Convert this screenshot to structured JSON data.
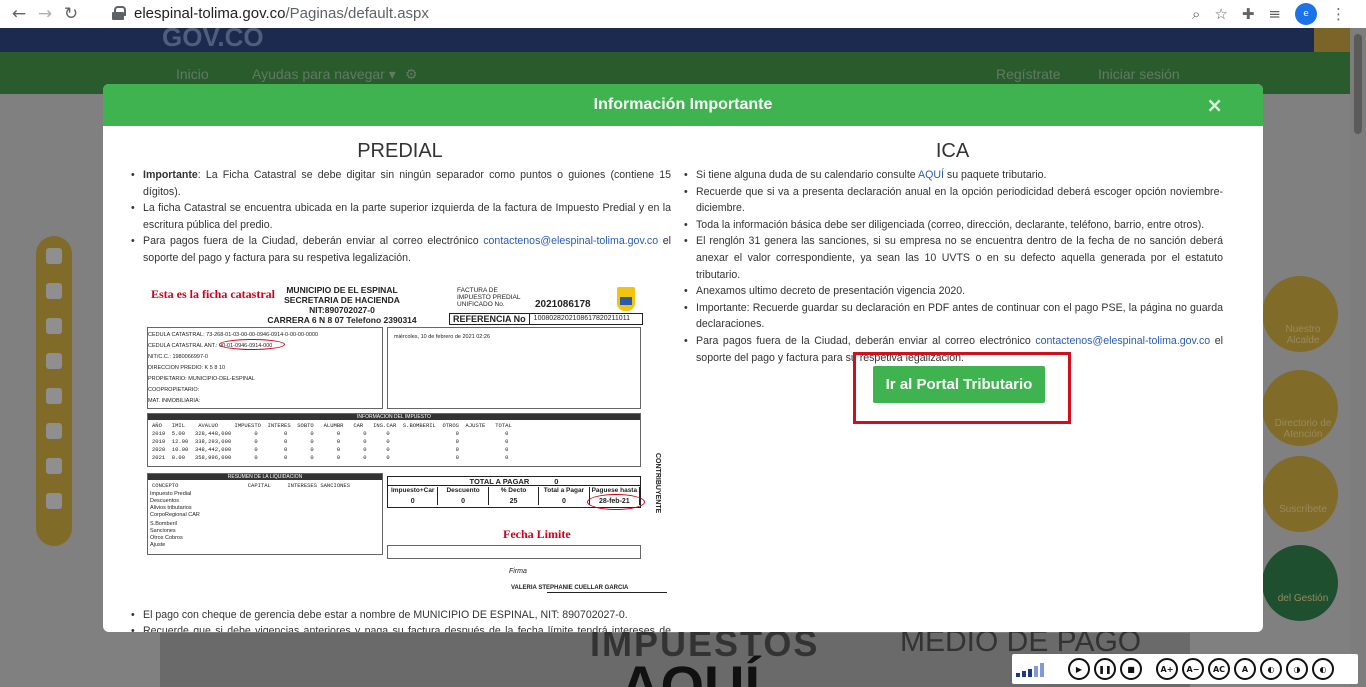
{
  "browser": {
    "url_domain": "elespinal-tolima.gov.co",
    "url_path": "/Paginas/default.aspx",
    "profile_initials": "e"
  },
  "background_page": {
    "logo_text": "GOV.CO",
    "nav": [
      "Inicio",
      "Ayudas para navegar ▾",
      "Regístrate",
      "Iniciar sesión"
    ],
    "side_buttons": [
      "Nuestro Alcalde",
      "Directorio de Atención",
      "Suscríbete",
      "del Gestión"
    ],
    "bottom_texts": [
      "IMPUESTOS",
      "MEDIO DE PAGO",
      "AQUÍ"
    ]
  },
  "modal": {
    "title": "Información Importante",
    "close_label": "×",
    "predial": {
      "heading": "PREDIAL",
      "items_top": [
        {
          "bold": "Importante",
          "text": ": La Ficha Catastral se debe digitar sin ningún separador como puntos o guiones (contiene 15 dígitos)."
        },
        {
          "bold": "",
          "text": "La ficha Catastral se encuentra ubicada en la parte superior izquierda de la factura de Impuesto Predial y en la escritura pública del predio."
        },
        {
          "bold": "",
          "text": "Para pagos fuera de la Ciudad, deberán enviar al correo electrónico ",
          "link": "contactenos@elespinal-tolima.gov.co",
          "after": " el soporte del pago y factura para su respetiva legalización."
        }
      ],
      "items_bottom": [
        "El pago con cheque de gerencia debe estar a nombre de MUNICIPIO DE ESPINAL, NIT: 890702027-0.",
        "Recuerde que si debe vigencias anteriores y paga su factura después de la fecha límite tendrá intereses de mora."
      ],
      "invoice": {
        "red_label": "Esta es la ficha catastral",
        "title_lines": [
          "MUNICIPIO DE EL ESPINAL",
          "SECRETARIA DE HACIENDA",
          "NIT:890702027-0",
          "CARRERA 6 N 8 07 Telefono 2390314"
        ],
        "factura_lines": [
          "FACTURA DE",
          "IMPUESTO PREDIAL",
          "UNIFICADO    No."
        ],
        "factura_number": "2021086178",
        "referencia_label": "REFERENCIA No",
        "referencia_value": "1008028202108617820211011",
        "fields": [
          "CEDULA CATASTRAL:    73-268-01-03-00-00-0946-0914-0-00-00-0000",
          "CEDULA CATASTRAL ANT.:   00-01-0946-0914-000",
          "NIT/C.C.:           1980066997-0",
          "DIRECCION PREDIO:   K 5 8 10",
          "PROPIETARIO:        MUNICIPIO-DEL-ESPINAL",
          "COOPROPIETARIO:",
          "MAT. INMOBILIARIA:"
        ],
        "fecha_expedicion": "miércoles, 10 de febrero de 2021 02:26",
        "impuesto_header": "INFORMACION DEL IMPUESTO",
        "impuesto_cols": "AÑO   IMIL    AVALUO     IMPUESTO  INTERES  SOBTO   ALUMBR   CAR   INS.CAR  S.BOMBERIL  OTROS  AJUSTE   TOTAL",
        "impuesto_rows": [
          "2019  5.00   328,448,000       0        0       0       0       0      0                    0              0",
          "2019  12.00  338,293,000       0        0       0       0       0      0                    0              0",
          "2020  10.00  348,442,000       0        0       0       0       0      0                    0              0",
          "2021  8.00   358,996,000       0        0       0       0       0      0                    0              0"
        ],
        "liquidacion_header": "RESUMEN DE LA LIQUIDACION",
        "liq_cols": "CONCEPTO                     CAPITAL     INTERESES SANCIONES",
        "liq_rows": [
          "Impuesto Predial",
          "Descuentos",
          "Alivios tributarios",
          "CorpoRegional CAR",
          "S.Bomberil",
          "Sanciones",
          "Otros Cobros",
          "Ajuste"
        ],
        "total_header": "TOTAL A PAGAR",
        "total_amount": "0",
        "total_cols": [
          "Impuesto+Car",
          "Descuento",
          "% Decto",
          "Total a Pagar",
          "Paguese hasta"
        ],
        "total_vals": [
          "0",
          "0",
          "25",
          "0",
          "28-feb-21"
        ],
        "fecha_limite": "Fecha Limite",
        "vertical_label": "CONTRIBUYENTE",
        "firma_label": "Firma",
        "signer": "VALERIA STEPHANIE CUELLAR GARCIA"
      }
    },
    "ica": {
      "heading": "ICA",
      "items": [
        {
          "text": "Si tiene alguna duda de su calendario consulte ",
          "link": "AQUÍ",
          "after": " su paquete tributario."
        },
        {
          "text": "Recuerde que si va a presenta declaración anual en la opción periodicidad deberá escoger opción noviembre-diciembre."
        },
        {
          "text": "Toda la información básica debe ser diligenciada (correo, dirección, declarante, teléfono, barrio, entre otros)."
        },
        {
          "text": "El renglón 31 genera las sanciones, si su empresa no se encuentra dentro de la fecha de no sanción deberá anexar el valor correspondiente, ya sean las 10 UVTS o en su defecto aquella generada por el estatuto tributario."
        },
        {
          "text": "Anexamos ultimo decreto de presentación vigencia 2020."
        },
        {
          "text": "Importante: Recuerde guardar su declaración en PDF antes de continuar con el pago PSE, la página no guarda declaraciones."
        },
        {
          "text": "Para pagos fuera de la Ciudad, deberán enviar al correo electrónico ",
          "link": "contactenos@elespinal-tolima.gov.co",
          "after": " el soporte del pago y factura para su respetiva legalización."
        }
      ],
      "portal_button": "Ir al Portal Tributario"
    }
  },
  "accessibility_bar": {
    "buttons": [
      "▶",
      "❚❚",
      "■",
      "A+",
      "A−",
      "AC",
      "A",
      "◐",
      "◑",
      "◐"
    ]
  },
  "colors": {
    "modal_header": "#3fb34f",
    "highlight_border": "#d0101c",
    "link": "#2a5db0"
  }
}
